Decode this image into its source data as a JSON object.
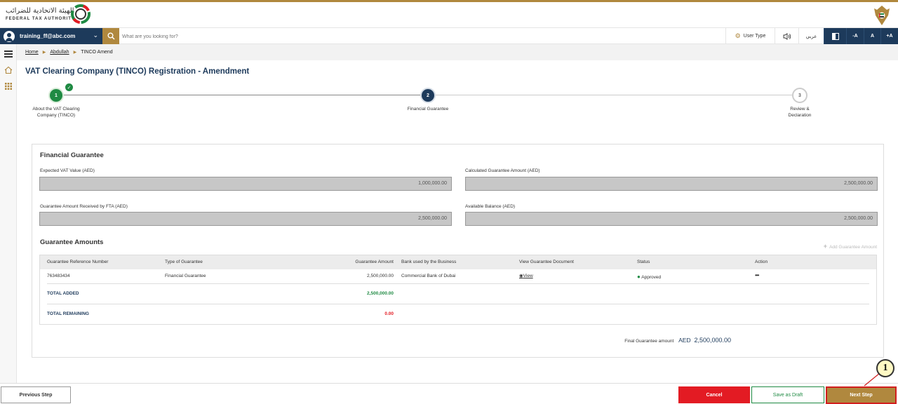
{
  "header": {
    "logo_arabic": "الهيئة الاتحادية للضرائب",
    "logo_english": "FEDERAL TAX AUTHORITY"
  },
  "navbar": {
    "user_email": "training_ff@abc.com",
    "search_placeholder": "What are you looking for?",
    "user_type_label": "User Type",
    "arabic_toggle": "عربي",
    "font_decrease": "-A",
    "font_normal": "A",
    "font_increase": "+A"
  },
  "breadcrumb": {
    "items": [
      "Home",
      "Abdullah",
      "TINCO Amend"
    ]
  },
  "page": {
    "title": "VAT Clearing Company (TINCO) Registration - Amendment"
  },
  "stepper": {
    "steps": [
      {
        "number": "1",
        "label": "About the VAT Clearing Company (TINCO)",
        "state": "completed"
      },
      {
        "number": "2",
        "label": "Financial Guarantee",
        "state": "active"
      },
      {
        "number": "3",
        "label": "Review & Declaration",
        "state": "pending"
      }
    ]
  },
  "financial_guarantee": {
    "title": "Financial Guarantee",
    "expected_vat_label": "Expected VAT Value (AED)",
    "expected_vat_value": "1,000,000.00",
    "calculated_guarantee_label": "Calculated Guarantee Amount (AED)",
    "calculated_guarantee_value": "2,500,000.00",
    "received_label": "Guarantee Amount Received by FTA (AED)",
    "received_value": "2,500,000.00",
    "available_label": "Available Balance (AED)",
    "available_value": "2,500,000.00"
  },
  "guarantee_amounts": {
    "title": "Guarantee Amounts",
    "add_label": "Add Guarantee Amount",
    "columns": [
      "Guarantee Reference Number",
      "Type of Guarantee",
      "Guarantee Amount",
      "Bank used by the Business",
      "View Guarantee Document",
      "Status",
      "Action"
    ],
    "rows": [
      {
        "reference": "763483434",
        "type": "Financial Guarantee",
        "amount": "2,500,000.00",
        "bank": "Commercial Bank of Dubai",
        "document": "View",
        "status": "Approved",
        "action": "•••"
      }
    ],
    "total_added_label": "TOTAL ADDED",
    "total_added_value": "2,500,000.00",
    "total_remaining_label": "TOTAL REMAINING",
    "total_remaining_value": "0.00",
    "final_label": "Final Guarantee amount",
    "final_currency": "AED",
    "final_value": "2,500,000.00"
  },
  "footer": {
    "previous": "Previous Step",
    "cancel": "Cancel",
    "save_draft": "Save as Draft",
    "next": "Next Step"
  },
  "annotation": {
    "marker": "1"
  },
  "colors": {
    "navy": "#1d3a5b",
    "gold": "#b0883e",
    "green": "#1f8a43",
    "red": "#e31b23"
  }
}
